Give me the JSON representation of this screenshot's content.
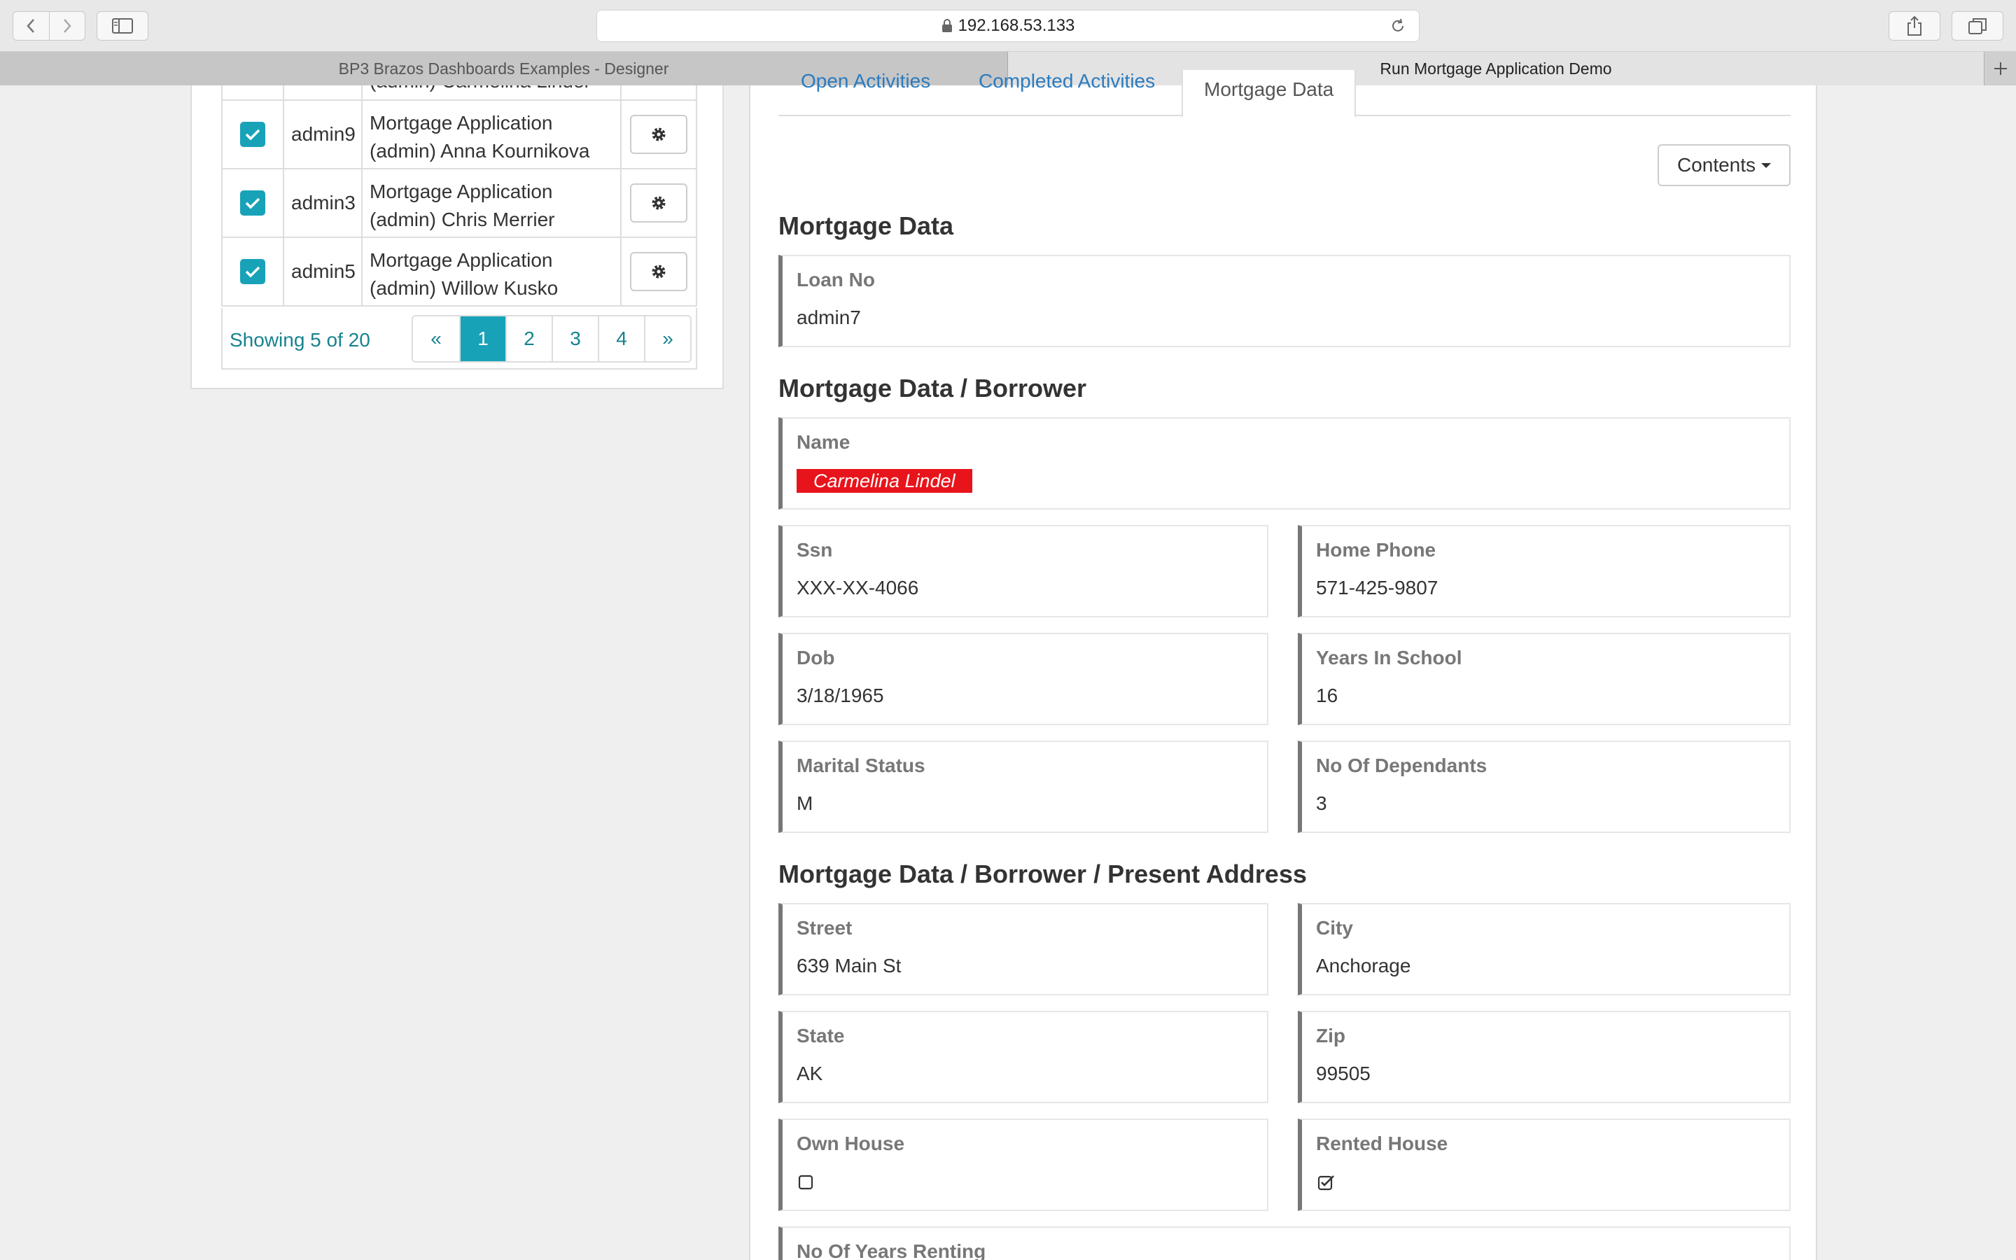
{
  "browser": {
    "address": "192.168.53.133",
    "tabs": [
      {
        "label": "BP3 Brazos Dashboards Examples - Designer"
      },
      {
        "label": "Run Mortgage Application Demo"
      }
    ]
  },
  "task_list": {
    "partial_row": {
      "name": "(admin) Carmelina Lindel"
    },
    "rows": [
      {
        "id": "admin9",
        "name_line1": "Mortgage Application",
        "name_line2": "(admin) Anna Kournikova"
      },
      {
        "id": "admin3",
        "name_line1": "Mortgage Application",
        "name_line2": "(admin) Chris Merrier"
      },
      {
        "id": "admin5",
        "name_line1": "Mortgage Application",
        "name_line2": "(admin) Willow Kusko"
      }
    ],
    "showing": "Showing 5 of 20",
    "pagination": {
      "prev": "«",
      "pages": [
        "1",
        "2",
        "3",
        "4"
      ],
      "next": "»",
      "current": "1"
    }
  },
  "detail": {
    "tabs": [
      "Open Activities",
      "Completed Activities",
      "Mortgage Data"
    ],
    "contents_label": "Contents",
    "sections": {
      "mortgage": "Mortgage Data",
      "borrower": "Mortgage Data / Borrower",
      "address": "Mortgage Data / Borrower / Present Address"
    },
    "fields": {
      "loan_no": {
        "label": "Loan No",
        "value": "admin7"
      },
      "name": {
        "label": "Name",
        "value": "Carmelina Lindel"
      },
      "ssn": {
        "label": "Ssn",
        "value": "XXX-XX-4066"
      },
      "home_phone": {
        "label": "Home Phone",
        "value": "571-425-9807"
      },
      "dob": {
        "label": "Dob",
        "value": "3/18/1965"
      },
      "years_in_school": {
        "label": "Years In School",
        "value": "16"
      },
      "marital_status": {
        "label": "Marital Status",
        "value": "M"
      },
      "no_of_dependants": {
        "label": "No Of Dependants",
        "value": "3"
      },
      "street": {
        "label": "Street",
        "value": "639 Main St"
      },
      "city": {
        "label": "City",
        "value": "Anchorage"
      },
      "state": {
        "label": "State",
        "value": "AK"
      },
      "zip": {
        "label": "Zip",
        "value": "99505"
      },
      "own_house": {
        "label": "Own House",
        "checked": false
      },
      "rented_house": {
        "label": "Rented House",
        "checked": true
      },
      "no_of_years_renting": {
        "label": "No Of Years Renting"
      }
    }
  },
  "colors": {
    "accent": "#17a2b8",
    "link": "#2a7bbf",
    "name_badge": "#e8141c"
  }
}
